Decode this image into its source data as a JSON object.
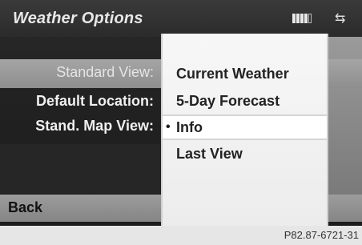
{
  "title": "Weather Options",
  "status_icons": [
    "signal-strength-icon",
    "connection-arrows-icon"
  ],
  "settings": [
    {
      "label": "Standard View:",
      "selected": true
    },
    {
      "label": "Default Location:",
      "selected": false
    },
    {
      "label": "Stand. Map View:",
      "selected": false
    }
  ],
  "back_label": "Back",
  "dropdown": {
    "options": [
      "Current Weather",
      "5-Day Forecast",
      "Info",
      "Last View"
    ],
    "active": "Info",
    "bullet": "•"
  },
  "figure_code": "P82.87-6721-31"
}
